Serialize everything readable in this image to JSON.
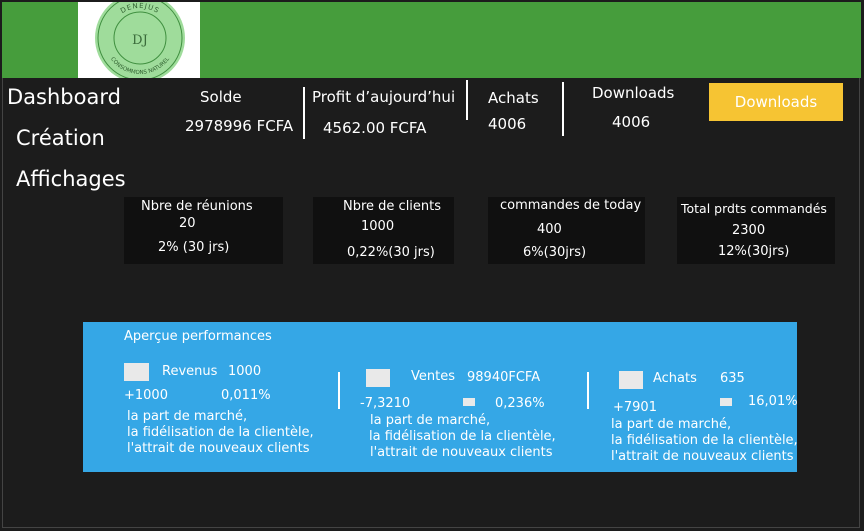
{
  "brand": {
    "name": "DENEJUS",
    "monogram": "DJ",
    "slogan": "CONSOMMONS NATUREL"
  },
  "nav": {
    "dashboard": "Dashboard",
    "creation": "Création",
    "affichages": "Affichages"
  },
  "header_stats": {
    "solde": {
      "label": "Solde",
      "value": "2978996 FCFA"
    },
    "profit": {
      "label": "Profit d’aujourd’hui",
      "value": "4562.00 FCFA"
    },
    "achats": {
      "label": "Achats",
      "value": "4006"
    },
    "downloads": {
      "label": "Downloads",
      "value": "4006"
    },
    "downloads_button": "Downloads"
  },
  "cards": [
    {
      "title": "Nbre de réunions",
      "value": "20",
      "trend": "2%  (30 jrs)"
    },
    {
      "title": "Nbre de clients",
      "value": "1000",
      "trend": "0,22%(30 jrs)"
    },
    {
      "title": "commandes de today",
      "value": "400",
      "trend": "6%(30jrs)"
    },
    {
      "title": "Total prdts commandés",
      "value": "2300",
      "trend": "12%(30jrs)"
    }
  ],
  "performance": {
    "title": "Aperçue performances",
    "blocks": [
      {
        "label": "Revenus",
        "value": "1000",
        "delta": "+1000",
        "percent": "0,011%",
        "line1": "la part de marché,",
        "line2": "la fidélisation de la clientèle,",
        "line3": " l'attrait de nouveaux clients"
      },
      {
        "label": "Ventes",
        "value": "98940FCFA",
        "delta": "-7,3210",
        "percent": "0,236%",
        "line1": "la part de marché,",
        "line2": "la fidélisation de la clientèle,",
        "line3": " l'attrait de nouveaux clients"
      },
      {
        "label": "Achats",
        "value": "635",
        "delta": "+7901",
        "percent": "16,01%",
        "line1": "la part de marché,",
        "line2": "la fidélisation de la clientèle,",
        "line3": " l'attrait de nouveaux clients"
      }
    ]
  },
  "colors": {
    "header_green": "#469d3c",
    "background": "#1c1c1c",
    "card": "#101010",
    "performance_blue": "#35a7e6",
    "button_yellow": "#f6c433"
  }
}
